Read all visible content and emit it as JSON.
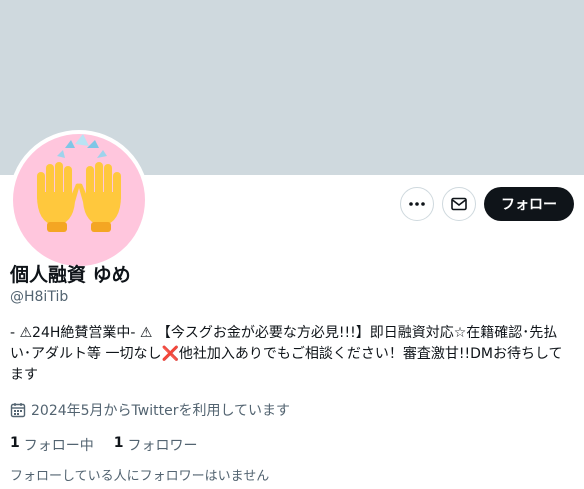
{
  "profile": {
    "name": "個人融資 ゆめ",
    "handle": "@H8iTib",
    "bio": "- ⚠︎24H絶賛営業中- ⚠︎ 【今スグお金が必要な方必見!!!】即日融資対応☆在籍確認･先払い･アダルト等 一切なし❌他社加入ありでもご相談ください！審査激甘!!DMお待ちしてます",
    "joined": "2024年5月からTwitterを利用しています",
    "following_count": "1",
    "following_label": "フォロー中",
    "followers_count": "1",
    "followers_label": "フォロワー",
    "mutual_text": "フォローしている人にフォロワーはいません"
  },
  "actions": {
    "follow_label": "フォロー",
    "more_icon": "more-horizontal-icon",
    "message_icon": "envelope-icon"
  },
  "avatar": {
    "icon": "raising-hands-emoji",
    "background": "#ffc6dd"
  },
  "colors": {
    "banner": "#cfd9de",
    "primary_text": "#0f1419",
    "secondary_text": "#536471",
    "follow_button_bg": "#0f1419"
  }
}
